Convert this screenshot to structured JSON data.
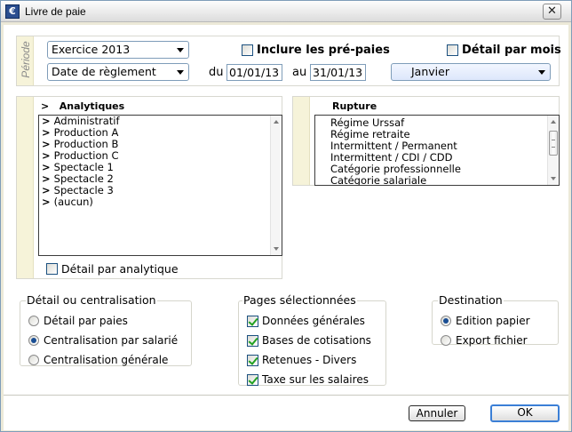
{
  "window": {
    "title": "Livre de paie",
    "close_glyph": "✕",
    "icon_glyph": "€"
  },
  "periode": {
    "label": "Période",
    "exercice": "Exercice 2013",
    "date_type": "Date de règlement",
    "include_prepaies": "Inclure les pré-paies",
    "include_prepaies_checked": false,
    "detail_par_mois": "Détail par mois",
    "detail_par_mois_checked": false,
    "du_label": "du",
    "au_label": "au",
    "date_from": "01/01/13",
    "date_to": "31/01/13",
    "month": "Janvier"
  },
  "analytiques": {
    "header": "Analytiques",
    "header_marker": ">",
    "items": [
      {
        "marker": ">",
        "label": "Administratif"
      },
      {
        "marker": ">",
        "label": "Production A"
      },
      {
        "marker": ">",
        "label": "Production B"
      },
      {
        "marker": ">",
        "label": "Production C"
      },
      {
        "marker": ">",
        "label": "Spectacle 1"
      },
      {
        "marker": ">",
        "label": "Spectacle 2"
      },
      {
        "marker": ">",
        "label": "Spectacle 3"
      },
      {
        "marker": ">",
        "label": "(aucun)"
      }
    ],
    "detail_label": "Détail par analytique",
    "detail_checked": false
  },
  "rupture": {
    "header": "Rupture",
    "items": [
      "Régime Urssaf",
      "Régime retraite",
      "Intermittent / Permanent",
      "Intermittent / CDI / CDD",
      "Catégorie professionnelle",
      "Catégorie salariale"
    ]
  },
  "detail_centralisation": {
    "title": "Détail ou centralisation",
    "options": [
      {
        "label": "Détail par paies",
        "selected": false
      },
      {
        "label": "Centralisation par salarié",
        "selected": true
      },
      {
        "label": "Centralisation générale",
        "selected": false
      }
    ]
  },
  "pages": {
    "title": "Pages sélectionnées",
    "items": [
      {
        "label": "Données générales",
        "checked": true
      },
      {
        "label": "Bases de cotisations",
        "checked": true
      },
      {
        "label": "Retenues - Divers",
        "checked": true
      },
      {
        "label": "Taxe sur les salaires",
        "checked": true
      }
    ]
  },
  "destination": {
    "title": "Destination",
    "options": [
      {
        "label": "Edition papier",
        "selected": true
      },
      {
        "label": "Export fichier",
        "selected": false
      }
    ]
  },
  "buttons": {
    "cancel": "Annuler",
    "ok": "OK"
  }
}
